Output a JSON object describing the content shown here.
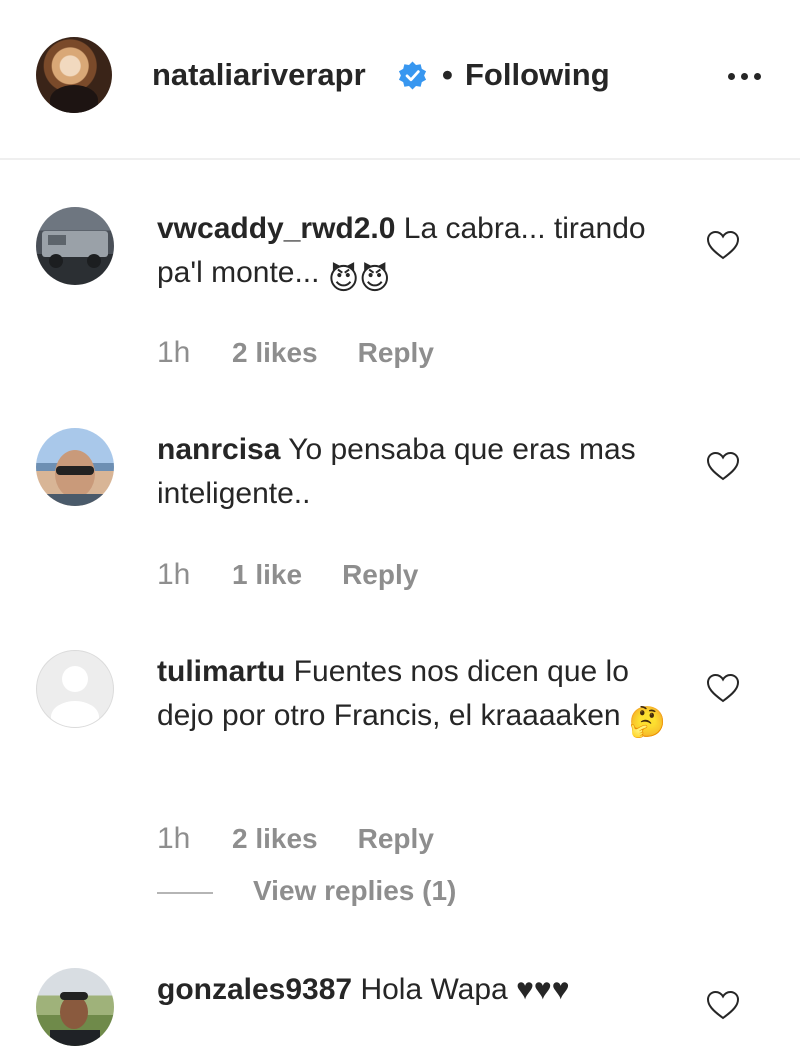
{
  "header": {
    "username": "natalia​riverapr",
    "separator": "•",
    "follow_label": "Following",
    "more_icon": "more-horizontal-icon",
    "verified_icon": "verified-badge-icon",
    "verified_color": "#3897f0"
  },
  "comments": [
    {
      "username": "vwcaddy_rwd2.0",
      "text": " La cabra... tirando pa'l monte... ",
      "emojis": "😈😈",
      "time": "1h",
      "likes": "2 likes",
      "reply": "Reply"
    },
    {
      "username": "nanrcisa",
      "text": " Yo pensaba que eras mas inteligente..",
      "time": "1h",
      "likes": "1 like",
      "reply": "Reply"
    },
    {
      "username": "tulimartu",
      "text": " Fuentes nos dicen que lo dejo por otro Francis, el kraaaaken ",
      "emojis": "🤔",
      "time": "1h",
      "likes": "2 likes",
      "reply": "Reply",
      "view_replies": "View replies (1)"
    },
    {
      "username": "gonzales9387",
      "text": " Hola Wapa ♥♥♥"
    }
  ],
  "colors": {
    "text": "#262626",
    "secondary": "#8e8e8e",
    "divider": "#efefef"
  }
}
